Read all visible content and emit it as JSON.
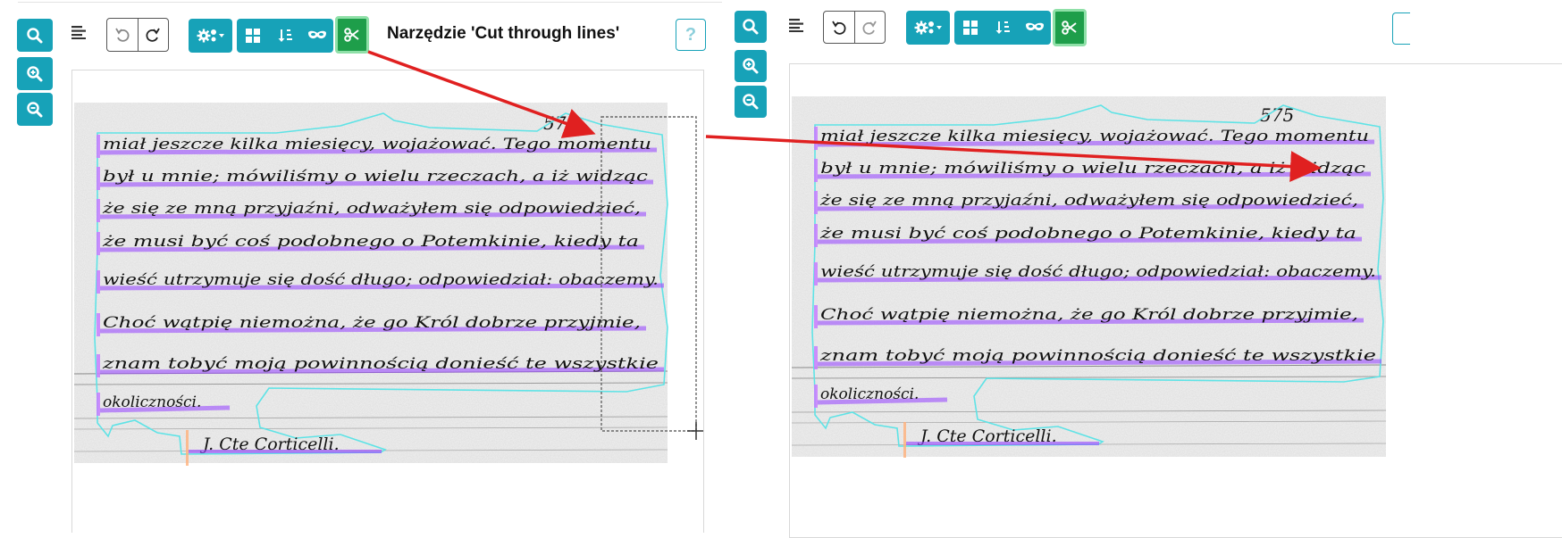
{
  "tool_title": "Narzędzie 'Cut through lines'",
  "help_label": "?",
  "page_number": "575",
  "manuscript_lines": [
    "miał jeszcze kilka miesięcy, wojażować. Tego momentu",
    "był u mnie; mówiliśmy o wielu rzeczach, a iż widząc",
    "że się ze mną przyjaźni, odważyłem się odpowiedzieć,",
    "że musi być coś podobnego o Potemkinie, kiedy ta",
    "wieść utrzymuje się dość długo; odpowiedział: obaczemy.",
    "Choć wątpię niemożna, że go Król dobrze przyjmie,",
    "znam tobyć moją powinnością donieść te wszystkie",
    "okoliczności."
  ],
  "signature": "J. Cte Corticelli.",
  "icons": {
    "search": "search-icon",
    "zoom_in": "zoom-in-icon",
    "zoom_out": "zoom-out-icon",
    "menu": "menu-lines-icon",
    "undo": "undo-icon",
    "redo": "redo-icon",
    "settings": "gears-icon",
    "grid": "grid-icon",
    "sort": "sort-icon",
    "mask": "mask-icon",
    "cut": "scissors-icon"
  },
  "colors": {
    "toolbar_accent": "#17a2b8",
    "active_tool": "#1e9e4a",
    "active_tool_border": "#8fe0a8",
    "region_outline": "#5ee3e6",
    "baseline_highlight": "#9b4dff",
    "signature_marker": "#ffb07a",
    "annotation_arrow": "#e02020"
  }
}
